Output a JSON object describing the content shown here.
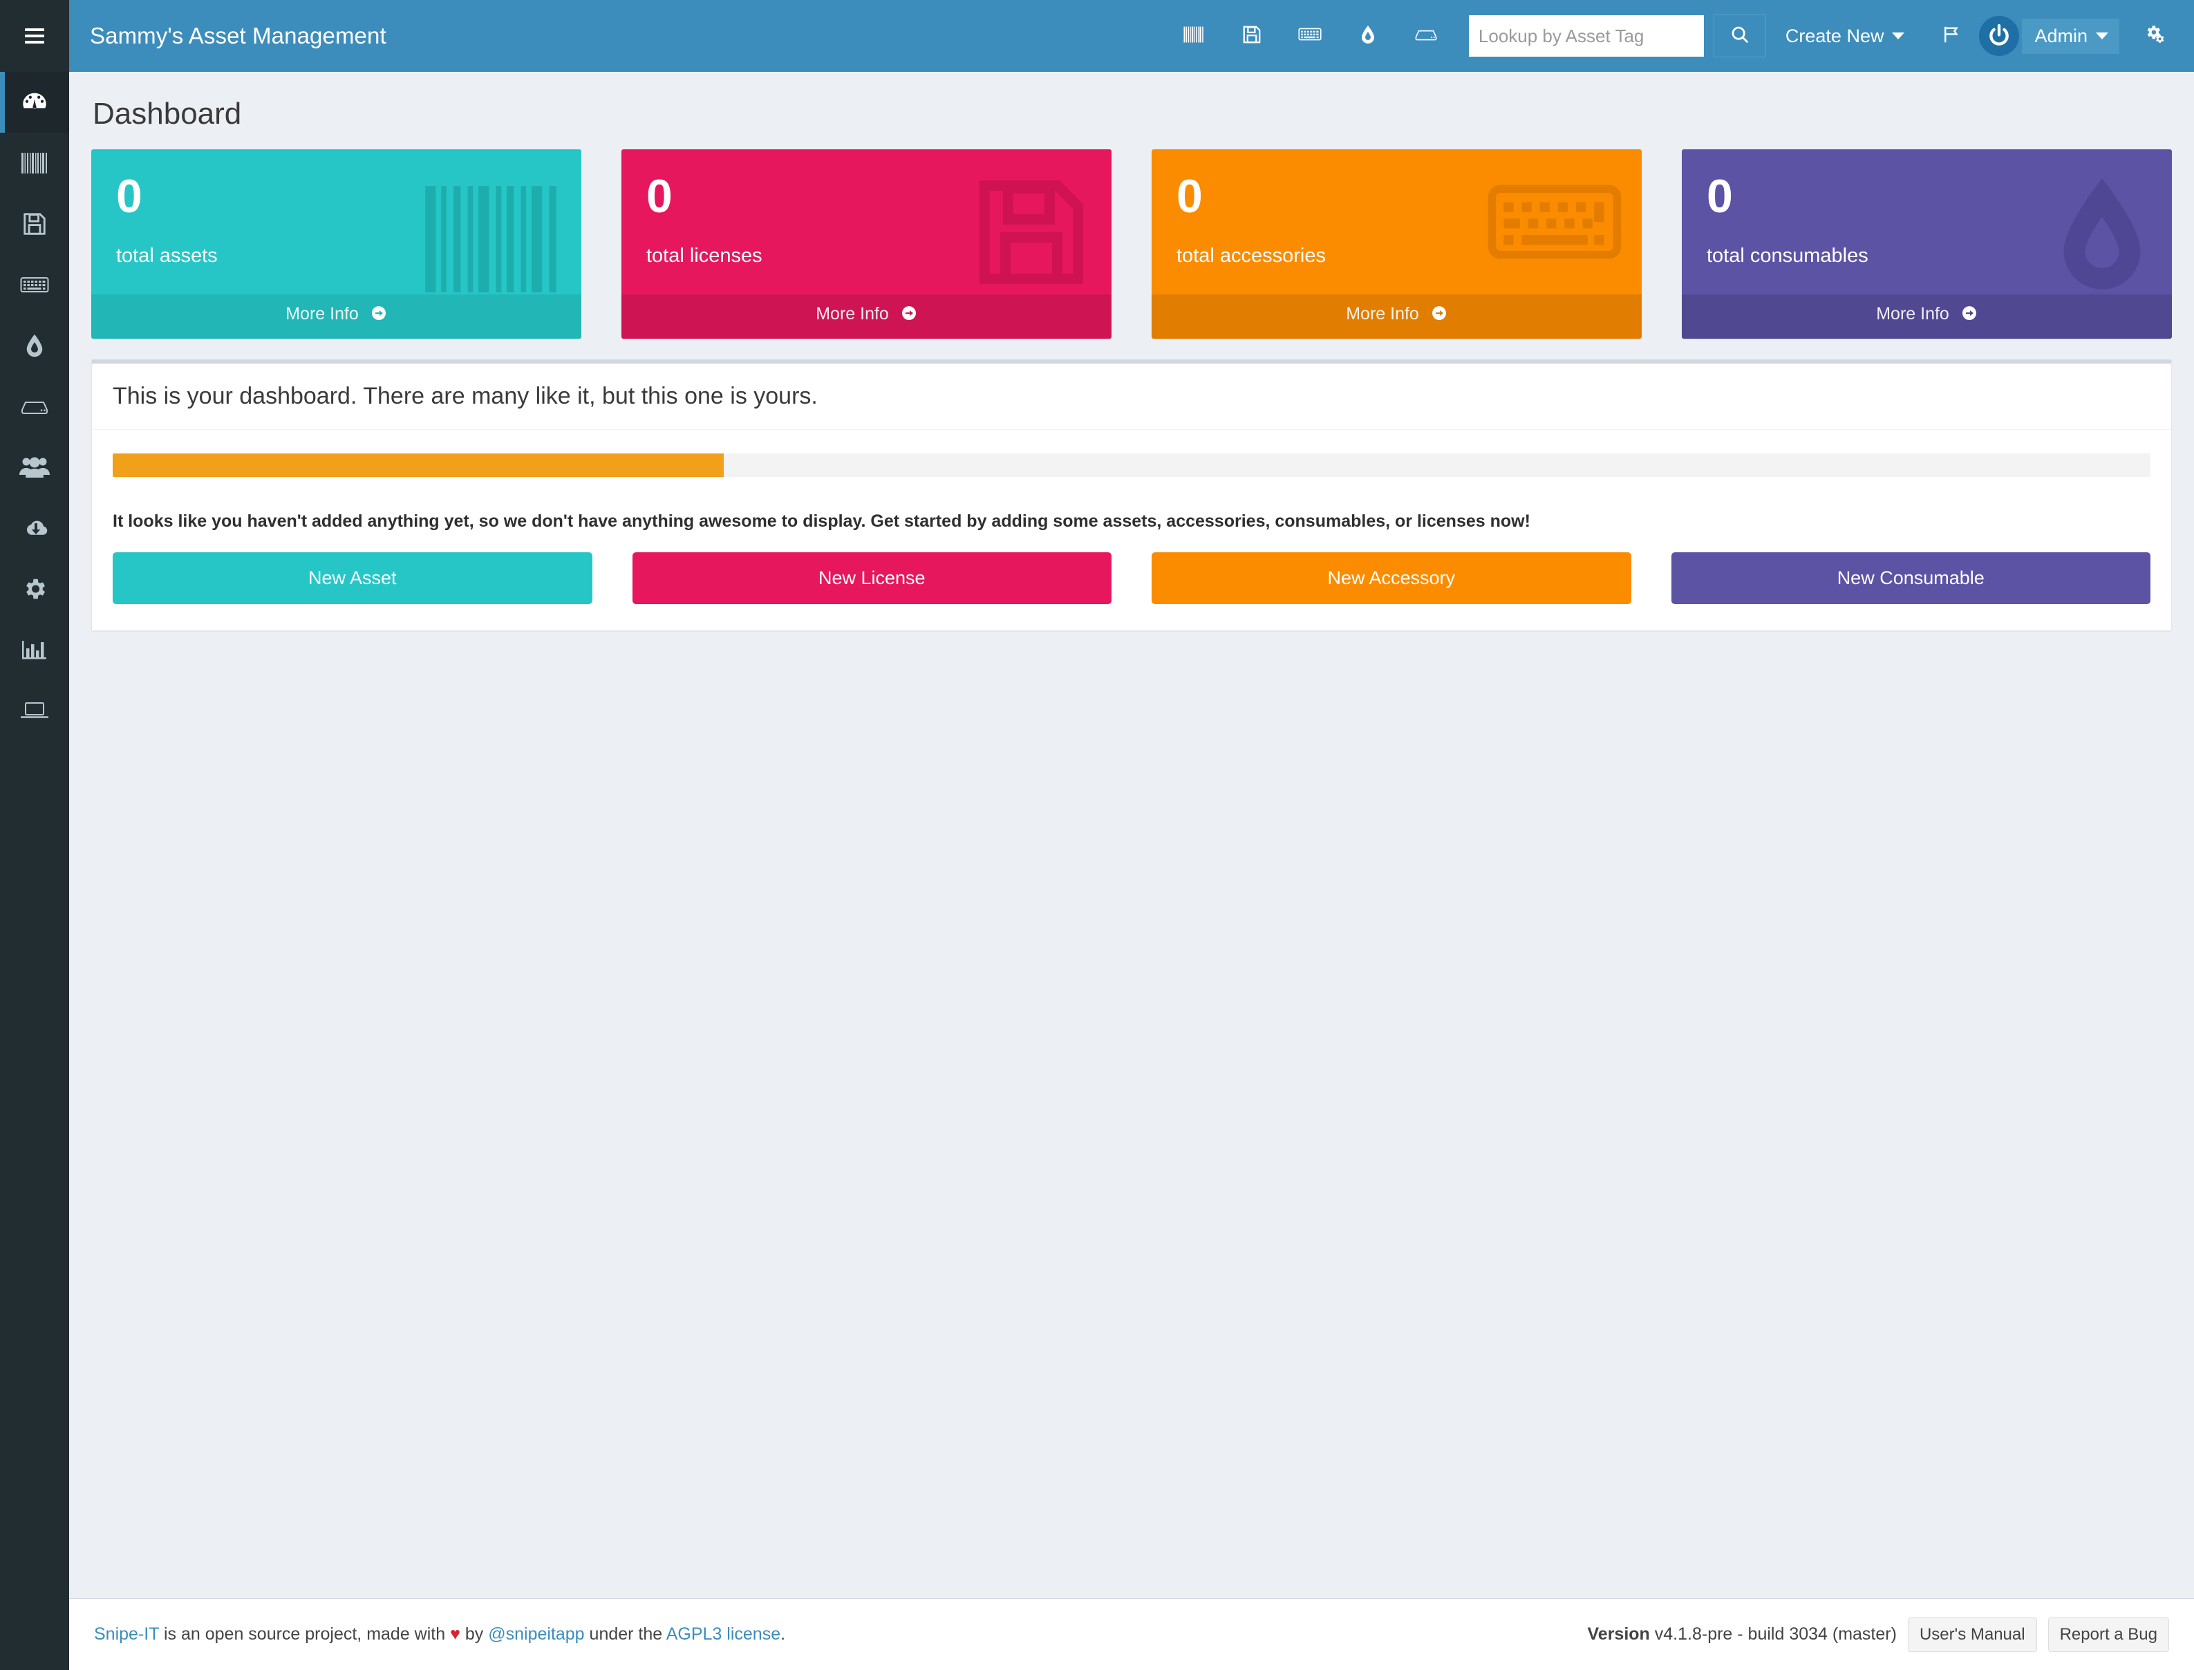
{
  "app": {
    "brand": "Sammy's Asset Management",
    "accent_blue": "#3c8dbc",
    "sidebar_bg": "#222d32",
    "content_bg": "#ecf0f5"
  },
  "header": {
    "quick_icons": [
      {
        "name": "barcode-icon",
        "label": "Assets"
      },
      {
        "name": "floppy-disk-icon",
        "label": "Licenses"
      },
      {
        "name": "keyboard-icon",
        "label": "Accessories"
      },
      {
        "name": "droplet-icon",
        "label": "Consumables"
      },
      {
        "name": "hdd-icon",
        "label": "Components"
      }
    ],
    "search": {
      "placeholder": "Lookup by Asset Tag",
      "value": "",
      "button_icon": "search-icon"
    },
    "create_new_label": "Create New",
    "flag_icon": "flag-icon",
    "user_label": "Admin",
    "settings_icon": "gears-icon"
  },
  "sidebar": {
    "toggle_icon": "hamburger-icon",
    "items": [
      {
        "name": "dashboard",
        "icon": "dashboard-tachometer-icon",
        "active": true
      },
      {
        "name": "assets",
        "icon": "barcode-icon",
        "active": false
      },
      {
        "name": "licenses",
        "icon": "floppy-disk-icon",
        "active": false
      },
      {
        "name": "accessories",
        "icon": "keyboard-icon",
        "active": false
      },
      {
        "name": "consumables",
        "icon": "droplet-icon",
        "active": false
      },
      {
        "name": "components",
        "icon": "hdd-icon",
        "active": false
      },
      {
        "name": "people",
        "icon": "users-icon",
        "active": false
      },
      {
        "name": "import",
        "icon": "cloud-download-icon",
        "active": false
      },
      {
        "name": "settings",
        "icon": "gear-icon",
        "active": false
      },
      {
        "name": "reports",
        "icon": "bar-chart-icon",
        "active": false
      },
      {
        "name": "requestable",
        "icon": "laptop-icon",
        "active": false
      }
    ]
  },
  "page": {
    "title": "Dashboard"
  },
  "cards": [
    {
      "count": "0",
      "label": "total assets",
      "more_info": "More Info",
      "color": "#26c6c6",
      "icon": "barcode-icon",
      "theme": "c-teal"
    },
    {
      "count": "0",
      "label": "total licenses",
      "more_info": "More Info",
      "color": "#e6175c",
      "icon": "floppy-disk-icon",
      "theme": "c-pink"
    },
    {
      "count": "0",
      "label": "total accessories",
      "more_info": "More Info",
      "color": "#fb8c00",
      "icon": "keyboard-icon",
      "theme": "c-orange"
    },
    {
      "count": "0",
      "label": "total consumables",
      "more_info": "More Info",
      "color": "#5c53a5",
      "icon": "droplet-icon",
      "theme": "c-purple"
    }
  ],
  "panel": {
    "heading": "This is your dashboard. There are many like it, but this one is yours.",
    "progress": {
      "percent": 30,
      "fill_color": "#f0a019",
      "track_color": "#f3f3f3"
    },
    "empty_message": "It looks like you haven't added anything yet, so we don't have anything awesome to display. Get started by adding some assets, accessories, consumables, or licenses now!",
    "buttons": [
      {
        "label": "New Asset",
        "theme": "b-teal",
        "color": "#26c6c6"
      },
      {
        "label": "New License",
        "theme": "b-pink",
        "color": "#e6175c"
      },
      {
        "label": "New Accessory",
        "theme": "b-orange",
        "color": "#fb8c00"
      },
      {
        "label": "New Consumable",
        "theme": "b-purple",
        "color": "#5c53a5"
      }
    ]
  },
  "footer": {
    "link_project": "Snipe-IT",
    "text_1": " is an open source project, made with ",
    "heart": "♥",
    "text_2": " by ",
    "link_handle": "@snipeitapp",
    "text_3": " under the ",
    "link_license": "AGPL3 license",
    "text_4": ".",
    "version_label": "Version",
    "version_value": " v4.1.8-pre - build 3034 (master)",
    "manual_button": "User's Manual",
    "bug_button": "Report a Bug"
  }
}
